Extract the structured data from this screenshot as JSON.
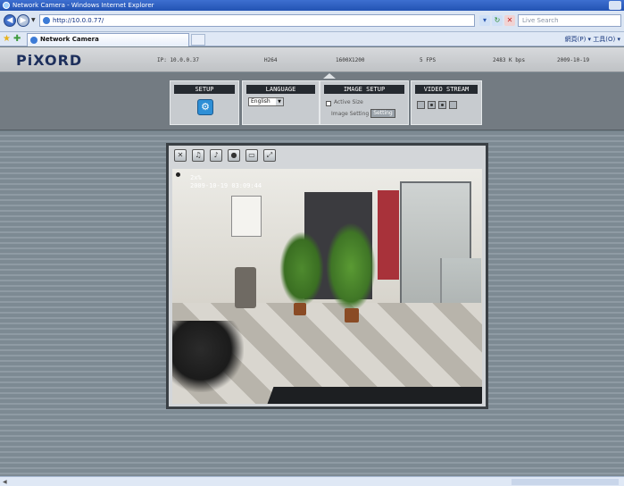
{
  "browser": {
    "window_title": "Network Camera - Windows Internet Explorer",
    "url": "http://10.0.0.77/",
    "search_placeholder": "Live Search",
    "tab_title": "Network Camera",
    "toolbar_right": "網頁(P) ▾ 工具(O) ▾"
  },
  "header": {
    "logo": "PiXORD",
    "ip": "IP: 10.0.0.37",
    "codec": "H264",
    "resolution": "1600X1200",
    "fps": "5 FPS",
    "bitrate": "2483 K bps",
    "date": "2009-10-19"
  },
  "controls": {
    "setup_title": "SETUP",
    "language_title": "LANGUAGE",
    "language_value": "English",
    "image_title": "IMAGE SETUP",
    "active_size_label": "Active Size",
    "image_setting_label": "Image Setting",
    "image_setting_btn": "Setting",
    "video_title": "VIDEO STREAM"
  },
  "video": {
    "osd_line1": "2x%",
    "osd_line2": "2009-10-19 03:09:44"
  },
  "ptz_icons": [
    "zoom-icon",
    "audio-icon",
    "microphone-icon",
    "record-icon",
    "snapshot-icon",
    "fullscreen-icon"
  ]
}
